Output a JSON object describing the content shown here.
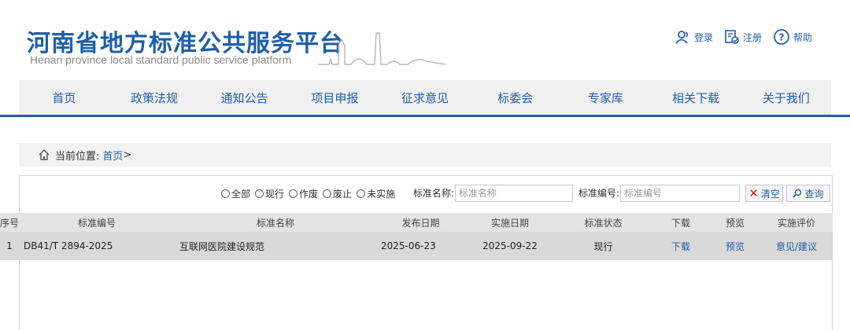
{
  "header": {
    "title": "河南省地方标准公共服务平台",
    "subtitle": "Henan province local standard public service platform",
    "links": [
      {
        "label": "登录",
        "icon": "user-icon"
      },
      {
        "label": "注册",
        "icon": "register-icon"
      },
      {
        "label": "帮助",
        "icon": "help-icon"
      }
    ]
  },
  "nav": {
    "items": [
      "首页",
      "政策法规",
      "通知公告",
      "项目申报",
      "征求意见",
      "标委会",
      "专家库",
      "相关下载",
      "关于我们"
    ]
  },
  "breadcrumb": {
    "prefix": "当前位置:",
    "home": "首页",
    "separator": ">"
  },
  "filter": {
    "radios": [
      "全部",
      "现行",
      "作废",
      "废止",
      "未实施"
    ],
    "name_label": "标准名称:",
    "name_placeholder": "标准名称",
    "code_label": "标准编号:",
    "code_placeholder": "标准编号",
    "clear_label": "清空",
    "search_label": "查询"
  },
  "table": {
    "headers": [
      "序号",
      "标准编号",
      "标准名称",
      "发布日期",
      "实施日期",
      "标准状态",
      "下载",
      "预览",
      "实施评价"
    ],
    "rows": [
      {
        "index": "1",
        "code": "DB41/T 2894-2025",
        "name": "互联网医院建设规范",
        "publish_date": "2025-06-23",
        "effective_date": "2025-09-22",
        "status": "现行",
        "download": "下载",
        "preview": "预览",
        "feedback": "意见/建议"
      }
    ]
  },
  "colors": {
    "brand": "#1f5fa8",
    "nav_bg": "#f0f0f0",
    "row_bg": "#d9d9d9",
    "clear_x": "#e02020"
  }
}
